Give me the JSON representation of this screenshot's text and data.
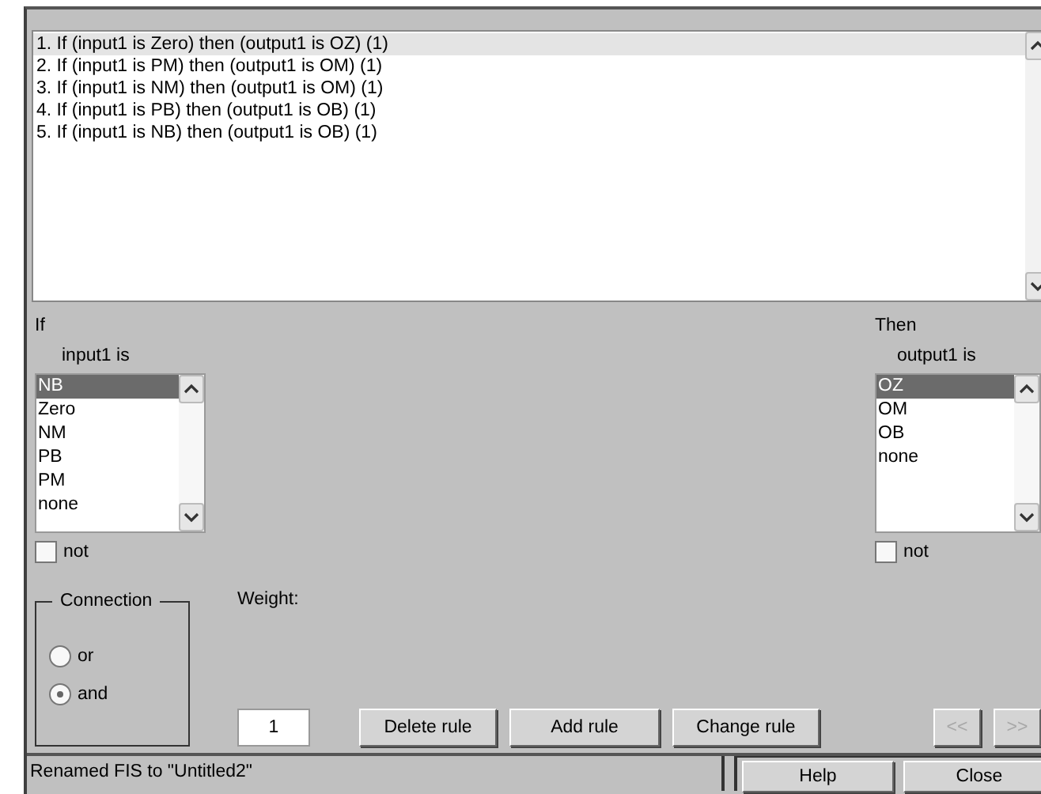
{
  "rules": [
    {
      "text": "1. If (input1 is Zero) then (output1 is OZ) (1)",
      "selected": true
    },
    {
      "text": "2. If (input1 is PM) then (output1 is OM) (1)",
      "selected": false
    },
    {
      "text": "3. If (input1 is NM) then (output1 is OM) (1)",
      "selected": false
    },
    {
      "text": "4. If (input1 is PB) then (output1 is OB) (1)",
      "selected": false
    },
    {
      "text": "5. If (input1 is NB) then (output1 is OB) (1)",
      "selected": false
    }
  ],
  "if": {
    "label": "If",
    "variable": "input1 is",
    "options": [
      {
        "label": "NB",
        "selected": true
      },
      {
        "label": "Zero",
        "selected": false
      },
      {
        "label": "NM",
        "selected": false
      },
      {
        "label": "PB",
        "selected": false
      },
      {
        "label": "PM",
        "selected": false
      },
      {
        "label": "none",
        "selected": false
      }
    ],
    "not_label": "not",
    "not": false
  },
  "then": {
    "label": "Then",
    "variable": "output1 is",
    "options": [
      {
        "label": "OZ",
        "selected": true
      },
      {
        "label": "OM",
        "selected": false
      },
      {
        "label": "OB",
        "selected": false
      },
      {
        "label": "none",
        "selected": false
      }
    ],
    "not_label": "not",
    "not": false
  },
  "connection": {
    "title": "Connection",
    "options": [
      {
        "label": "or",
        "selected": false
      },
      {
        "label": "and",
        "selected": true
      }
    ]
  },
  "weight": {
    "label": "Weight:",
    "value": "1"
  },
  "buttons": [
    "Delete rule",
    "Add rule",
    "Change rule"
  ],
  "nav": [
    {
      "label": "<<",
      "disabled": true
    },
    {
      "label": ">>",
      "disabled": true
    }
  ],
  "status": "Renamed FIS to \"Untitled2\"",
  "footer_buttons": [
    "Help",
    "Close"
  ]
}
